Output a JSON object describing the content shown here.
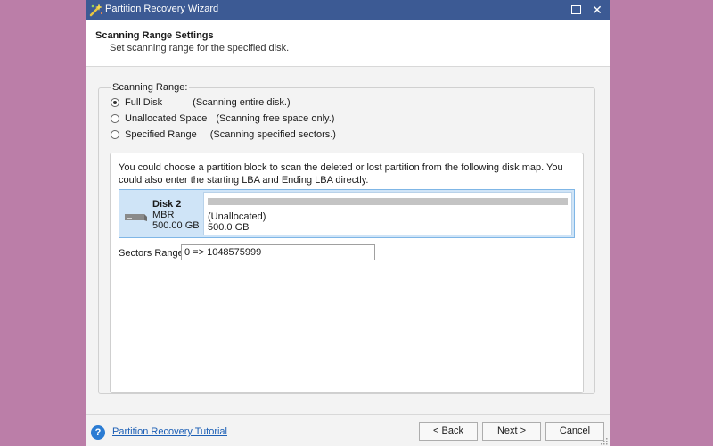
{
  "window": {
    "title": "Partition Recovery Wizard",
    "app_icon": "wizard-sparkle-icon",
    "maximize_icon": "maximize-icon",
    "close_icon": "close-icon",
    "close_glyph": "✕"
  },
  "header": {
    "title": "Scanning Range Settings",
    "subtitle": "Set scanning range for the specified disk."
  },
  "scanning_range": {
    "legend": "Scanning Range:",
    "selected": "full_disk",
    "options": [
      {
        "id": "full_disk",
        "label": "Full Disk",
        "description": "(Scanning entire disk.)",
        "checked": true
      },
      {
        "id": "unallocated",
        "label": "Unallocated Space",
        "description": "(Scanning free space only.)",
        "checked": false
      },
      {
        "id": "specified",
        "label": "Specified Range",
        "description": "(Scanning specified sectors.)",
        "checked": false
      }
    ]
  },
  "disk_map": {
    "info": "You could choose a partition block to scan the deleted or lost partition from the following disk map. You could also enter the starting LBA and Ending LBA directly.",
    "disk": {
      "name": "Disk 2",
      "type": "MBR",
      "size": "500.00 GB",
      "icon": "hard-disk-icon"
    },
    "partition": {
      "label": "(Unallocated)",
      "size": "500.0 GB"
    }
  },
  "sectors": {
    "label": "Sectors Range:",
    "value": "0 => 1048575999"
  },
  "footer": {
    "help_icon": "help-icon",
    "help_glyph": "?",
    "tutorial_link": "Partition Recovery Tutorial",
    "back_label": "< Back",
    "next_label": "Next >",
    "cancel_label": "Cancel"
  },
  "colors": {
    "desktop": "#bb7ea8",
    "titlebar": "#3c5a94",
    "selection": "#cfe4f7",
    "link": "#1c5fb5"
  }
}
